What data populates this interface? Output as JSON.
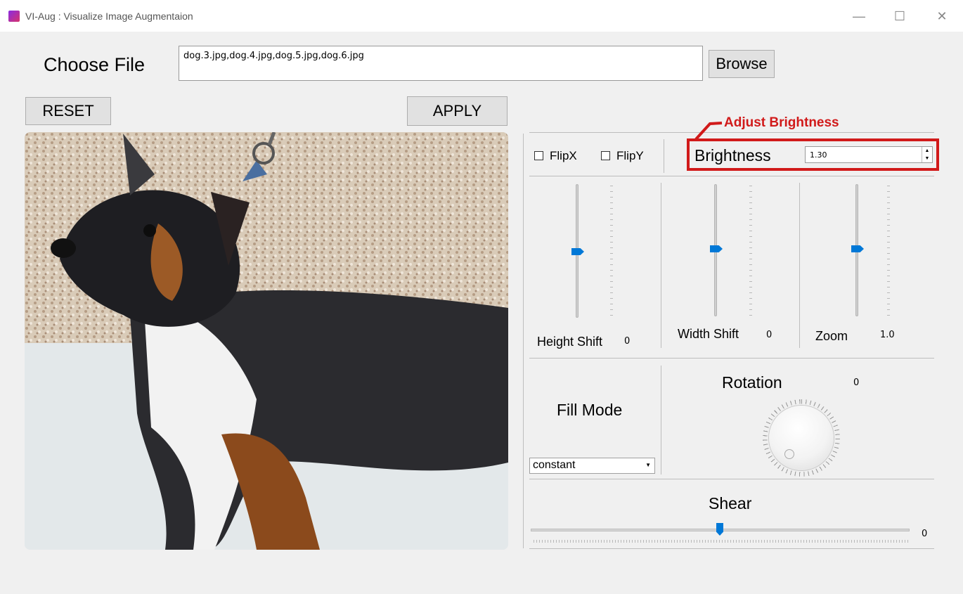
{
  "window": {
    "title": "VI-Aug : Visualize Image Augmentaion",
    "minimize": "—",
    "maximize": "☐",
    "close": "✕"
  },
  "file": {
    "label": "Choose File",
    "value": "dog.3.jpg,dog.4.jpg,dog.5.jpg,dog.6.jpg",
    "browse_label": "Browse"
  },
  "actions": {
    "reset_label": "RESET",
    "apply_label": "APPLY"
  },
  "preview": {
    "description": "dog photo"
  },
  "flip": {
    "flipx_label": "FlipX",
    "flipy_label": "FlipY",
    "flipx_checked": false,
    "flipy_checked": false
  },
  "brightness": {
    "label": "Brightness",
    "value": "1.30",
    "annotation": "Adjust Brightness"
  },
  "sliders": {
    "height_shift": {
      "label": "Height Shift",
      "value": "0"
    },
    "width_shift": {
      "label": "Width Shift",
      "value": "0"
    },
    "zoom": {
      "label": "Zoom",
      "value": "1.0"
    }
  },
  "fill_mode": {
    "label": "Fill Mode",
    "selected": "constant"
  },
  "rotation": {
    "label": "Rotation",
    "value": "0"
  },
  "shear": {
    "label": "Shear",
    "value": "0"
  },
  "colors": {
    "accent": "#0078d7",
    "annotation": "#d11a1a",
    "background": "#f0f0f0"
  }
}
